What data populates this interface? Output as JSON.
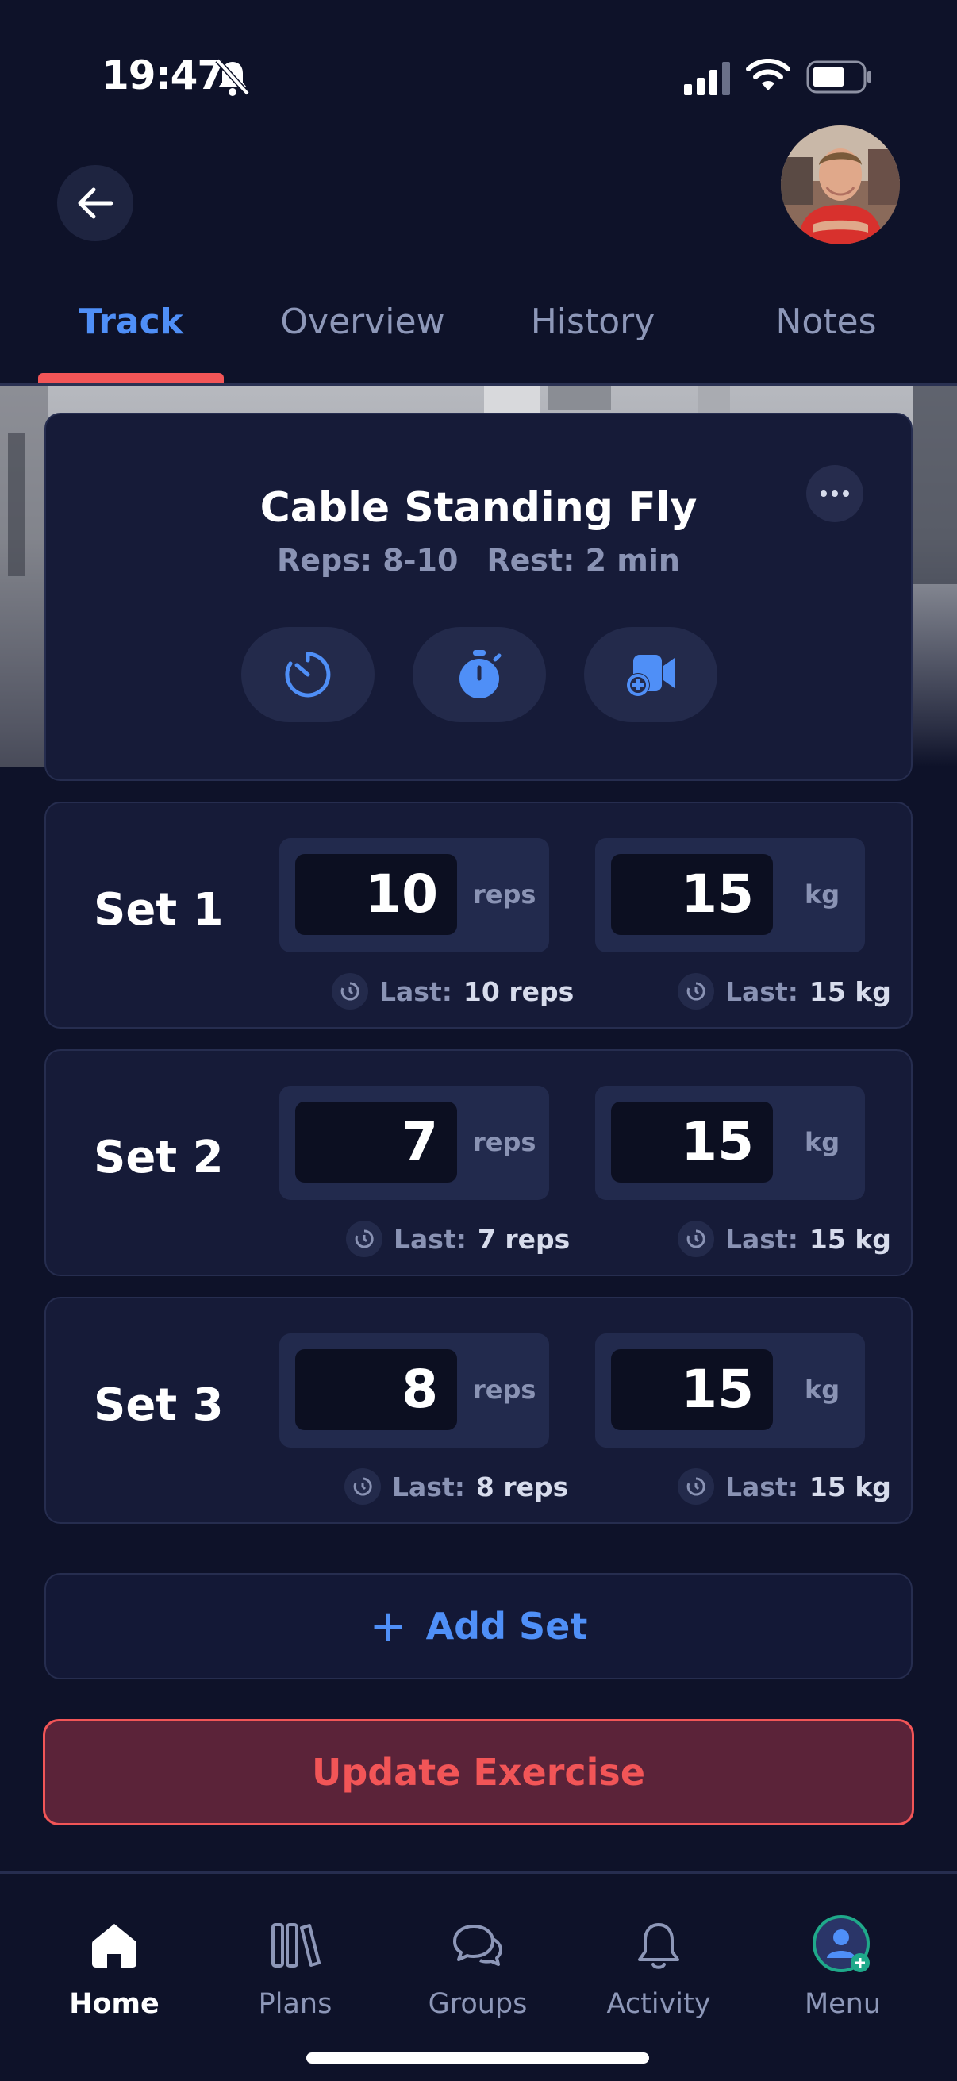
{
  "status_bar": {
    "time": "19:47"
  },
  "tabs": [
    {
      "label": "Track",
      "active": true
    },
    {
      "label": "Overview",
      "active": false
    },
    {
      "label": "History",
      "active": false
    },
    {
      "label": "Notes",
      "active": false
    }
  ],
  "exercise": {
    "title": "Cable Standing Fly",
    "reps": "Reps: 8-10",
    "rest": "Rest: 2 min",
    "actions": [
      "timer-icon",
      "stopwatch-icon",
      "add-video-icon"
    ]
  },
  "sets": [
    {
      "label": "Set 1",
      "reps": "10",
      "reps_unit": "reps",
      "weight": "15",
      "weight_unit": "kg",
      "last_label": "Last:",
      "last_reps": "10 reps",
      "last_weight": "15 kg"
    },
    {
      "label": "Set 2",
      "reps": "7",
      "reps_unit": "reps",
      "weight": "15",
      "weight_unit": "kg",
      "last_label": "Last:",
      "last_reps": "7 reps",
      "last_weight": "15 kg"
    },
    {
      "label": "Set 3",
      "reps": "8",
      "reps_unit": "reps",
      "weight": "15",
      "weight_unit": "kg",
      "last_label": "Last:",
      "last_reps": "8 reps",
      "last_weight": "15 kg"
    }
  ],
  "add_set_label": "Add Set",
  "update_label": "Update Exercise",
  "nav": [
    {
      "label": "Home",
      "icon": "home-icon",
      "active": true
    },
    {
      "label": "Plans",
      "icon": "plans-icon",
      "active": false
    },
    {
      "label": "Groups",
      "icon": "groups-icon",
      "active": false
    },
    {
      "label": "Activity",
      "icon": "bell-icon",
      "active": false
    },
    {
      "label": "Menu",
      "icon": "menu-avatar-icon",
      "active": false
    }
  ],
  "colors": {
    "accent": "#4f8ff7",
    "danger": "#f25557",
    "background": "#0e1229",
    "card": "#161b38"
  }
}
